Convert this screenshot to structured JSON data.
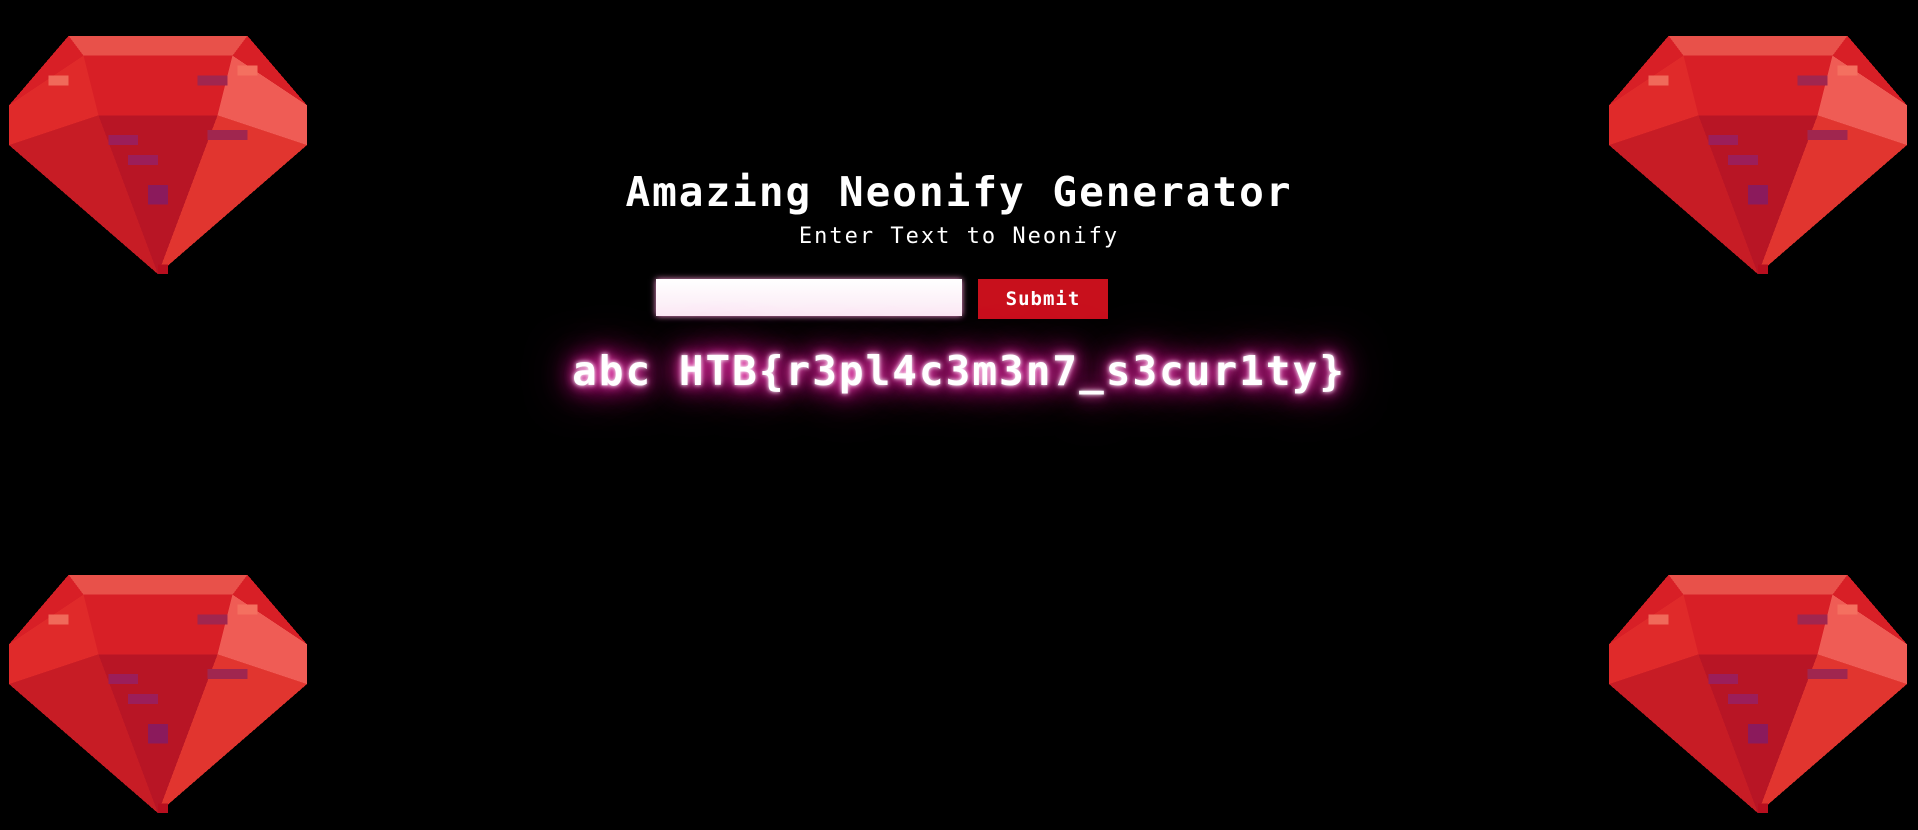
{
  "page": {
    "title": "Amazing Neonify Generator",
    "subtitle": "Enter Text to Neonify"
  },
  "form": {
    "input_value": "",
    "input_placeholder": "",
    "submit_label": "Submit"
  },
  "output": {
    "neon_text": "abc HTB{r3pl4c3m3n7_s3cur1ty}"
  },
  "decorations": {
    "icon": "ruby-gem-icon",
    "colors": {
      "background": "#000000",
      "submit": "#c8101c",
      "neon_glow": "#ff1aa8"
    }
  }
}
